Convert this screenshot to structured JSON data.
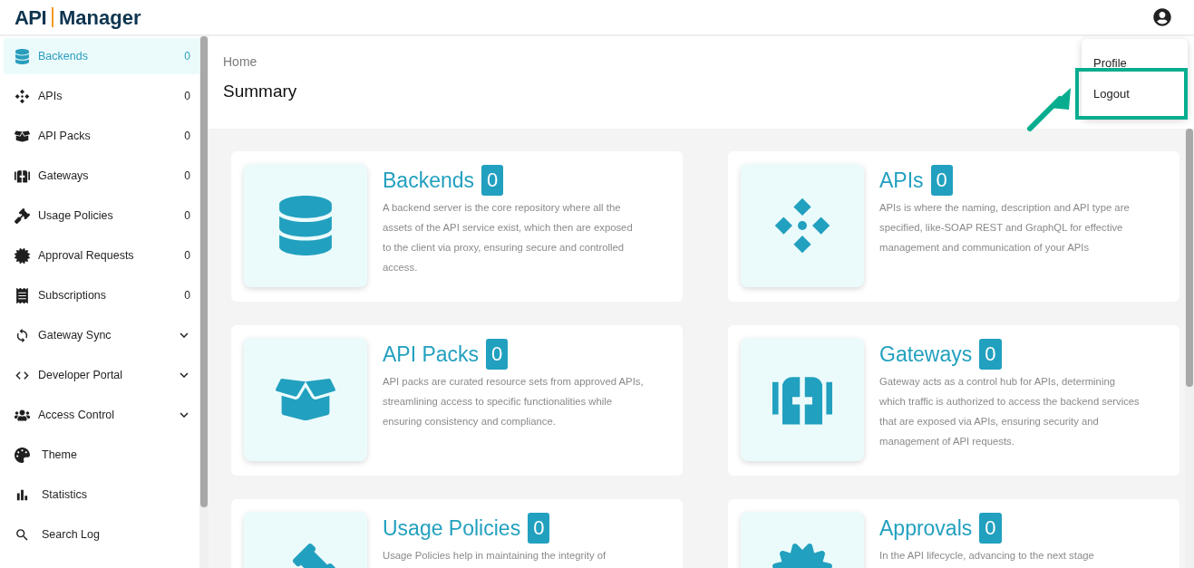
{
  "header": {
    "logo": {
      "mark": "API",
      "name": "Manager"
    }
  },
  "user_menu": {
    "items": [
      {
        "label": "Profile",
        "annotated": false
      },
      {
        "label": "Logout",
        "annotated": true
      }
    ]
  },
  "sidebar": {
    "items": [
      {
        "label": "Backends",
        "kind": "count",
        "count": "0",
        "selected": true
      },
      {
        "label": "APIs",
        "kind": "count",
        "count": "0",
        "selected": false
      },
      {
        "label": "API Packs",
        "kind": "count",
        "count": "0",
        "selected": false
      },
      {
        "label": "Gateways",
        "kind": "count",
        "count": "0",
        "selected": false
      },
      {
        "label": "Usage Policies",
        "kind": "count",
        "count": "0",
        "selected": false
      },
      {
        "label": "Approval Requests",
        "kind": "count",
        "count": "0",
        "selected": false
      },
      {
        "label": "Subscriptions",
        "kind": "count",
        "count": "0",
        "selected": false
      },
      {
        "label": "Gateway Sync",
        "kind": "group",
        "selected": false
      },
      {
        "label": "Developer Portal",
        "kind": "group",
        "selected": false
      },
      {
        "label": "Access Control",
        "kind": "group",
        "selected": false
      },
      {
        "label": "Theme",
        "kind": "plain",
        "selected": false
      },
      {
        "label": "Statistics",
        "kind": "plain",
        "selected": false
      },
      {
        "label": "Search Log",
        "kind": "plain",
        "selected": false
      }
    ]
  },
  "breadcrumb": "Home",
  "page_title": "Summary",
  "cards": [
    {
      "title": "Backends",
      "count": "0",
      "description": "A backend server is the core repository where all the assets of the API service exist, which then are exposed to the client via proxy, ensuring secure and controlled access."
    },
    {
      "title": "APIs",
      "count": "0",
      "description": "APIs is where the naming, description and API type are specified, like-SOAP REST and GraphQL for effective management and communication of your APIs"
    },
    {
      "title": "API Packs",
      "count": "0",
      "description": "API packs are curated resource sets from approved APIs, streamlining access to specific functionalities while ensuring consistency and compliance."
    },
    {
      "title": "Gateways",
      "count": "0",
      "description": "Gateway acts as a control hub for APIs, determining which traffic is authorized to access the backend services that are exposed via APIs, ensuring security and management of API requests."
    },
    {
      "title": "Usage Policies",
      "count": "0",
      "description": "Usage Policies help in maintaining the integrity of"
    },
    {
      "title": "Approvals",
      "count": "0",
      "description": "In the API lifecycle, advancing to the next stage"
    }
  ]
}
